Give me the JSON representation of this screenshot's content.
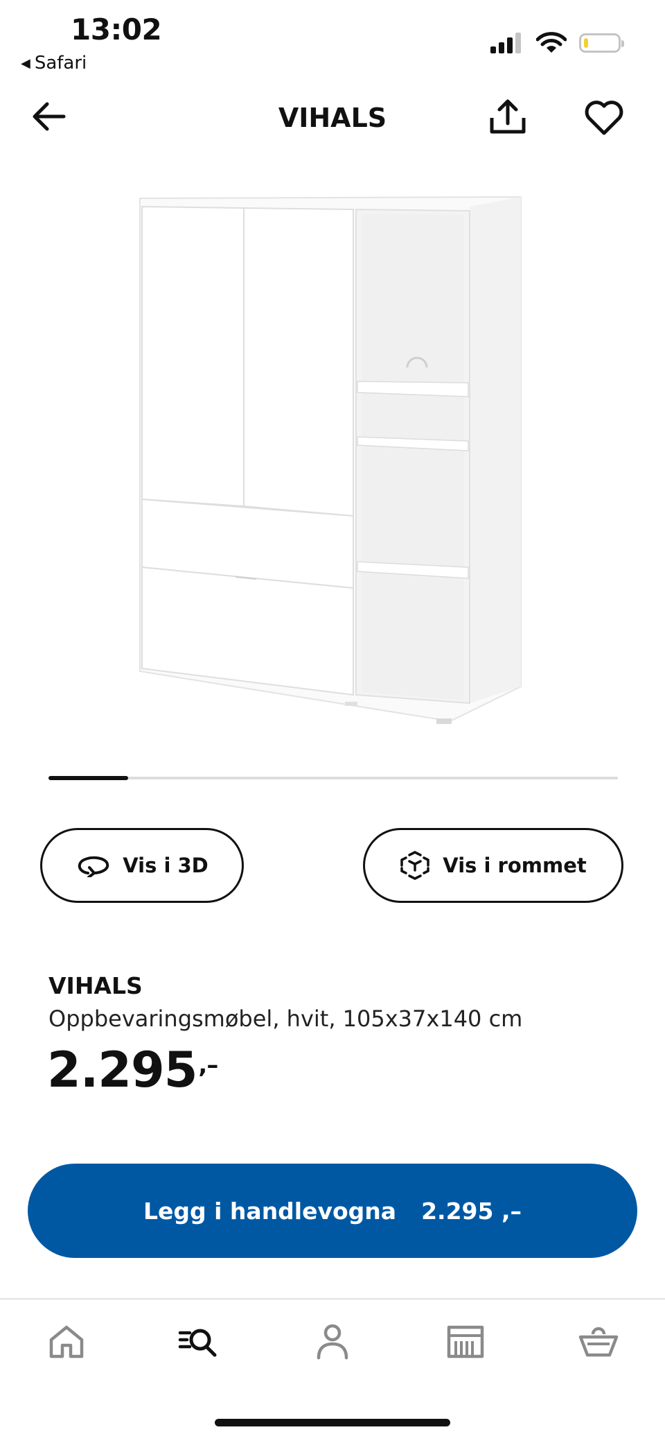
{
  "status_bar": {
    "time": "13:02",
    "back_app": "Safari",
    "battery_level": 0.12,
    "battery_color": "#f2d22e"
  },
  "nav": {
    "title": "VIHALS",
    "back_icon": "arrow-left-icon",
    "share_icon": "share-icon",
    "favorite_icon": "heart-icon"
  },
  "gallery": {
    "image": "white-storage-cabinet-image",
    "progress": 0.14
  },
  "actions": {
    "view_3d_label": "Vis i 3D",
    "view_3d_icon": "rotate-3d-icon",
    "view_room_label": "Vis i rommet",
    "view_room_icon": "ar-cube-icon"
  },
  "product": {
    "name": "VIHALS",
    "description": "Oppbevaringsmøbel, hvit, 105x37x140 cm",
    "price": "2.295",
    "price_suffix": ",–"
  },
  "cta": {
    "label": "Legg i handlevogna",
    "price": "2.295 ,–",
    "color": "#0058a3"
  },
  "tabs": [
    {
      "name": "home",
      "icon": "home-icon"
    },
    {
      "name": "search",
      "icon": "search-list-icon",
      "active": true
    },
    {
      "name": "profile",
      "icon": "person-icon"
    },
    {
      "name": "store",
      "icon": "store-icon"
    },
    {
      "name": "cart",
      "icon": "basket-icon"
    }
  ]
}
